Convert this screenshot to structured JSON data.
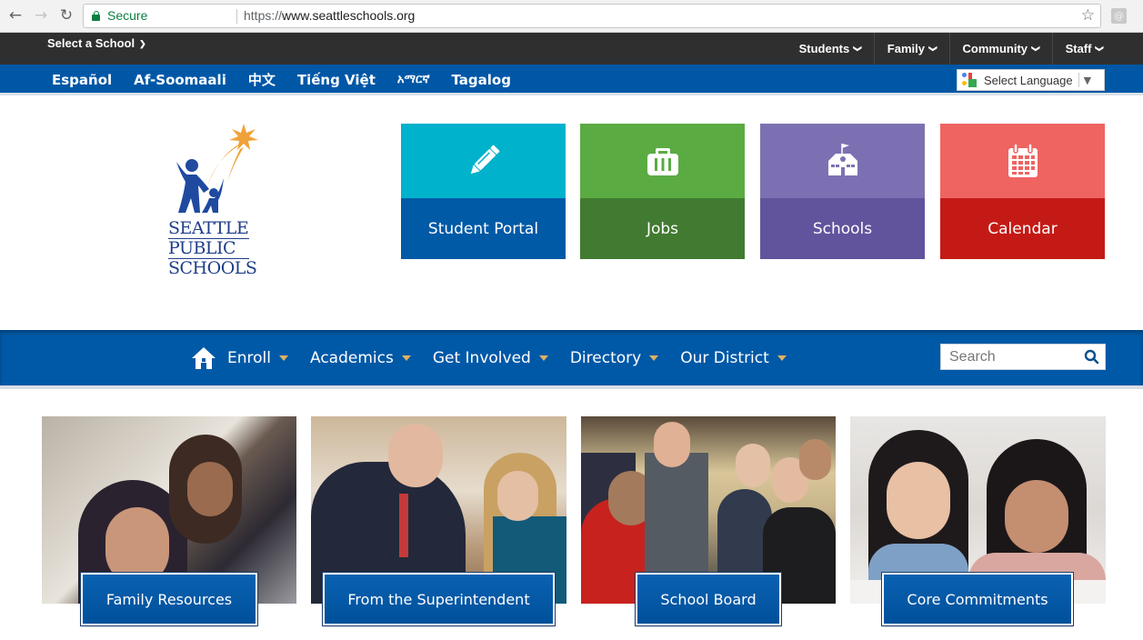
{
  "browser": {
    "back_icon": "arrow-left",
    "forward_icon": "arrow-right",
    "reload_icon": "reload",
    "secure_label": "Secure",
    "url_scheme": "https://",
    "url_host": "www.seattleschools.org",
    "bookmark_icon": "star",
    "extension_icon": "@"
  },
  "topbar": {
    "select_school": "Select a School",
    "audience": [
      {
        "label": "Students"
      },
      {
        "label": "Family"
      },
      {
        "label": "Community"
      },
      {
        "label": "Staff"
      }
    ]
  },
  "langbar": {
    "languages": [
      "Español",
      "Af-Soomaali",
      "中文",
      "Tiếng Việt",
      "አማርኛ",
      "Tagalog"
    ],
    "translate_label": "Select Language"
  },
  "logo": {
    "lines": [
      "SEATTLE",
      "PUBLIC",
      "SCHOOLS"
    ]
  },
  "tiles": [
    {
      "label": "Student Portal",
      "icon": "pencil-icon",
      "top_color": "#00b2cb",
      "bottom_color": "#005aa6"
    },
    {
      "label": "Jobs",
      "icon": "briefcase-icon",
      "top_color": "#5bab43",
      "bottom_color": "#417b31"
    },
    {
      "label": "Schools",
      "icon": "schoolhouse-icon",
      "top_color": "#7d70b2",
      "bottom_color": "#62549c"
    },
    {
      "label": "Calendar",
      "icon": "calendar-icon",
      "top_color": "#ef6461",
      "bottom_color": "#c41a15"
    }
  ],
  "mainnav": {
    "home_icon": "home-icon",
    "items": [
      {
        "label": "Enroll"
      },
      {
        "label": "Academics"
      },
      {
        "label": "Get Involved"
      },
      {
        "label": "Directory"
      },
      {
        "label": "Our District"
      }
    ],
    "search_placeholder": "Search"
  },
  "cards": [
    {
      "label": "Family Resources"
    },
    {
      "label": "From the Superintendent"
    },
    {
      "label": "School Board"
    },
    {
      "label": "Core Commitments"
    }
  ],
  "colors": {
    "brand_blue": "#0059a7",
    "topbar_dark": "#2f2f2f",
    "caret_gold": "#e0b060"
  }
}
